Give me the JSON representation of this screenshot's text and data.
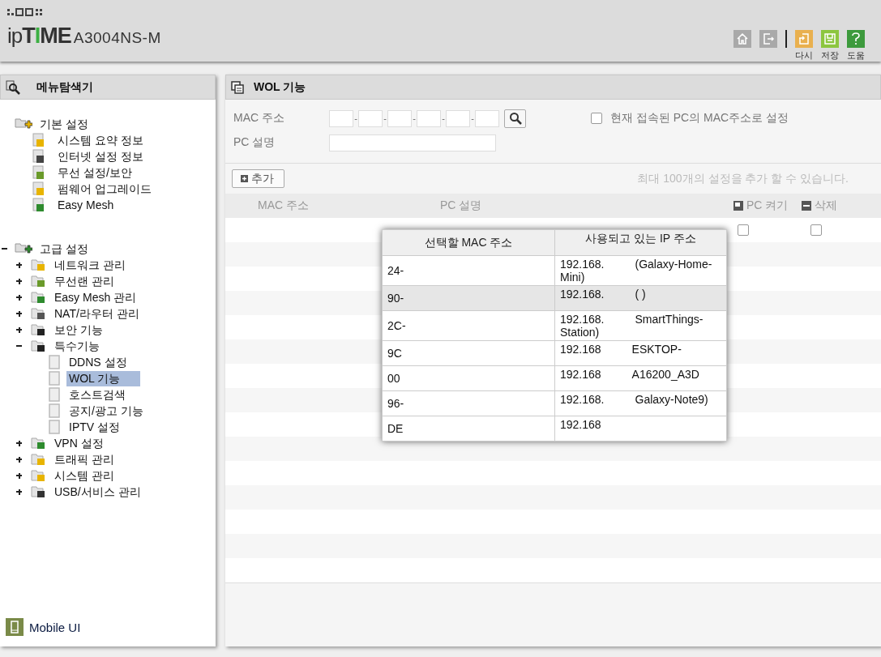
{
  "header": {
    "logo_dots": "ipTIME",
    "model": "A3004NS-M",
    "tools": [
      {
        "kind": "home"
      },
      {
        "kind": "logout"
      },
      {
        "kind": "reset",
        "label": "다시"
      },
      {
        "kind": "save",
        "label": "저장"
      },
      {
        "kind": "help",
        "label": "도움"
      }
    ]
  },
  "sidebar": {
    "title": "메뉴탐색기",
    "groups": [
      {
        "label": "기본 설정",
        "children": [
          {
            "label": "시스템 요약 정보",
            "selected": false
          },
          {
            "label": "인터넷 설정 정보",
            "selected": false
          },
          {
            "label": "무선 설정/보안",
            "selected": false
          },
          {
            "label": "펌웨어 업그레이드",
            "selected": false
          },
          {
            "label": "Easy Mesh",
            "selected": false
          }
        ]
      },
      {
        "label": "고급 설정",
        "expanded": true,
        "children": [
          {
            "label": "네트워크 관리",
            "expanded": false,
            "selected": false
          },
          {
            "label": "무선랜 관리",
            "expanded": false,
            "selected": false
          },
          {
            "label": "Easy Mesh 관리",
            "expanded": false,
            "selected": false
          },
          {
            "label": "NAT/라우터 관리",
            "expanded": false,
            "selected": false
          },
          {
            "label": "보안 기능",
            "expanded": false,
            "selected": false
          },
          {
            "label": "특수기능",
            "expanded": true,
            "selected": false,
            "children": [
              {
                "label": "DDNS 설정",
                "selected": false
              },
              {
                "label": "WOL 기능",
                "selected": true
              },
              {
                "label": "호스트검색",
                "selected": false
              },
              {
                "label": "공지/광고 기능",
                "selected": false
              },
              {
                "label": "IPTV 설정",
                "selected": false
              }
            ]
          },
          {
            "label": "VPN 설정",
            "expanded": false,
            "selected": false
          },
          {
            "label": "트래픽 관리",
            "expanded": false,
            "selected": false
          },
          {
            "label": "시스템 관리",
            "expanded": false,
            "selected": false
          },
          {
            "label": "USB/서비스 관리",
            "expanded": false,
            "selected": false
          }
        ]
      }
    ],
    "mobile_link": "Mobile UI"
  },
  "main": {
    "title": "WOL 기능",
    "form": {
      "mac_label": "MAC 주소",
      "mac_separator": "-",
      "current_pc": {
        "label": "현재 접속된 PC의 MAC주소로 설정",
        "checked": false
      },
      "desc_label": "PC 설명"
    },
    "add_button": "추가",
    "limit_note": "최대 100개의 설정을 추가 할 수 있습니다.",
    "table": {
      "columns": [
        "MAC 주소",
        "PC 설명",
        "PC 켜기",
        "삭제"
      ],
      "rows": [
        {
          "wake": false,
          "delete": false
        }
      ]
    },
    "popup": {
      "columns": [
        "선택할 MAC 주소",
        "사용되고 있는 IP 주소"
      ],
      "rows": [
        {
          "mac": "24-",
          "ip": "192.168.",
          "host": "(Galaxy-Home-Mini)",
          "selected": false
        },
        {
          "mac": "90-",
          "ip": "192.168.",
          "host": "(      )",
          "selected": true
        },
        {
          "mac": "2C-",
          "ip": "192.168.",
          "host": "SmartThings-Station)",
          "selected": false
        },
        {
          "mac": "9C",
          "ip": "192.168",
          "host": "ESKTOP-",
          "selected": false
        },
        {
          "mac": "00",
          "ip": "192.168",
          "host": "A16200_A3D",
          "selected": false
        },
        {
          "mac": "96-",
          "ip": "192.168.",
          "host": "Galaxy-Note9)",
          "selected": false
        },
        {
          "mac": "DE",
          "ip": "192.168",
          "selected": false
        }
      ]
    }
  }
}
